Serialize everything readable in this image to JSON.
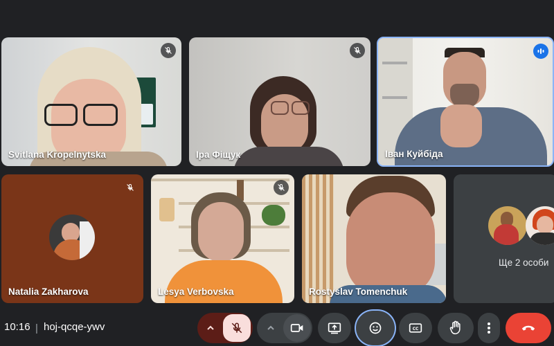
{
  "meeting": {
    "time": "10:16",
    "separator": "|",
    "code": "hoj-qcqe-ywv"
  },
  "participants": [
    {
      "name": "Svitlana Kropelnytska",
      "muted": true
    },
    {
      "name": "Іра Фіщук",
      "muted": true
    },
    {
      "name": "Іван Куйбіда",
      "muted": false,
      "speaking": true
    },
    {
      "name": "Natalia Zakharova",
      "muted": true
    },
    {
      "name": "Lesya Verbovska",
      "muted": true
    },
    {
      "name": "Rostyslav Tomenchuk",
      "muted": false
    }
  ],
  "others_tile": {
    "label": "Ще 2 особи"
  },
  "controls": [
    {
      "icon": "chevron-up-icon"
    },
    {
      "icon": "mic-off-icon"
    },
    {
      "icon": "chevron-up-icon"
    },
    {
      "icon": "camera-icon"
    },
    {
      "icon": "present-screen-icon"
    },
    {
      "icon": "emoji-icon"
    },
    {
      "icon": "captions-icon"
    },
    {
      "icon": "raise-hand-icon"
    },
    {
      "icon": "more-options-icon"
    },
    {
      "icon": "end-call-icon"
    }
  ],
  "colors": {
    "background": "#202124",
    "tile": "#3c4043",
    "mic_muted_bg": "#f9dedc",
    "end_call": "#ea4335",
    "speaking_border": "#8ab4f8",
    "accent_blue": "#1a73e8"
  }
}
